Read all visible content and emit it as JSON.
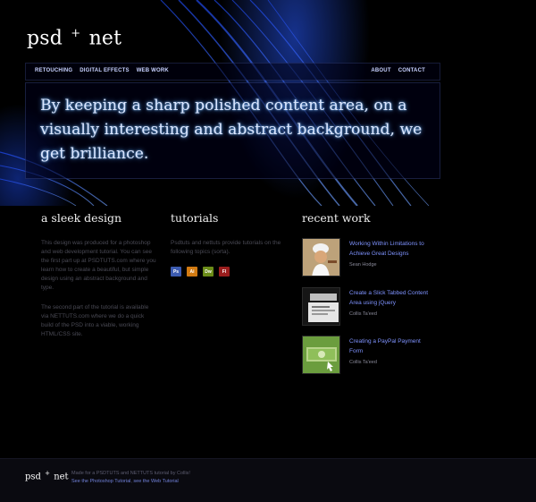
{
  "site": {
    "logo_left": "psd",
    "logo_plus": "+",
    "logo_right": "net"
  },
  "nav": {
    "left": [
      "RETOUCHING",
      "DIGITAL EFFECTS",
      "WEB WORK"
    ],
    "right": [
      "ABOUT",
      "CONTACT"
    ]
  },
  "hero": {
    "text": "By keeping a sharp polished content area, on a visually interesting and abstract background, we get brilliance."
  },
  "columns": {
    "sleek": {
      "title": "a sleek design",
      "p1": "This design was produced for a photoshop and web development tutorial.  You can see the first part up at PSDTUTS.com where you learn how to create a beautiful, but simple design using an abstract background and type.",
      "p2": "The second part of the tutorial is available via NETTUTS.com where we do a quick build of the PSD into a viable, working HTML/CSS site."
    },
    "tutorials": {
      "title": "tutorials",
      "p1": "Psdtuts and nettuts provide tutorials on the following topics (sorta).",
      "icons": [
        {
          "label": "Ps",
          "name": "photoshop-icon",
          "color": "#3c5bb0"
        },
        {
          "label": "Ai",
          "name": "illustrator-icon",
          "color": "#d17a12"
        },
        {
          "label": "Dw",
          "name": "dreamweaver-icon",
          "color": "#6b8c18"
        },
        {
          "label": "Fl",
          "name": "flash-icon",
          "color": "#9a1d1d"
        }
      ]
    },
    "recent": {
      "title": "recent work",
      "items": [
        {
          "title": "Working Within Limitations to Achieve Great Designs",
          "author": "Sean Hodge"
        },
        {
          "title": "Create a Slick Tabbed Content Area using jQuery",
          "author": "Collis Ta'eed"
        },
        {
          "title": "Creating a PayPal Payment Form",
          "author": "Collis Ta'eed"
        }
      ]
    }
  },
  "footer": {
    "logo_left": "psd",
    "logo_plus": "+",
    "logo_right": "net",
    "line1": "Made for a PSDTUTS and NETTUTS tutorial by Collis!",
    "line2_a": "See the Photoshop Tutorial",
    "line2_sep": ", ",
    "line2_b": "see the Web Tutorial"
  }
}
